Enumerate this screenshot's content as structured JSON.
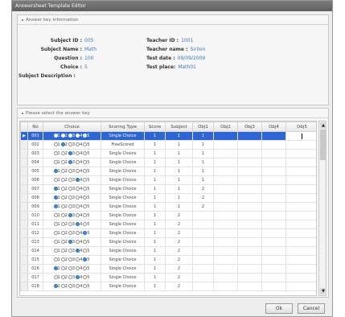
{
  "window": {
    "title": "Answersheet Template Editor"
  },
  "info": {
    "header": "Answer key Information",
    "subject_id_label": "Subject ID :",
    "subject_id": "005",
    "subject_name_label": "Subject Name :",
    "subject_name": "Math",
    "question_label": "Question :",
    "question": "100",
    "choice_label": "Choice :",
    "choice": "5",
    "subject_desc_label": "Subject Description :",
    "teacher_id_label": "Teacher ID :",
    "teacher_id": "1001",
    "teacher_name_label": "Teacher name :",
    "teacher_name": "Sirilon",
    "test_date_label": "Test date :",
    "test_date": "09/09/2009",
    "test_place_label": "Test place:",
    "test_place": "Math01"
  },
  "key": {
    "header": "Please select the answer key",
    "columns": [
      "No",
      "Choice",
      "Scoring Type",
      "Score",
      "Subject",
      "Obj1",
      "Obj2",
      "Obj3",
      "Obj4",
      "Obj5"
    ],
    "choice_numbers": [
      "1",
      "2",
      "3",
      "4",
      "5"
    ],
    "selected_row": 0,
    "current_row_marker": "▶",
    "rows": [
      {
        "no": "001",
        "on": [
          1,
          2,
          3,
          4
        ],
        "type": "Single Choice",
        "score": "1",
        "subject": "1",
        "obj1": "1"
      },
      {
        "no": "002",
        "on": [
          2
        ],
        "type": "FreeScored",
        "score": "1",
        "subject": "1",
        "obj1": "1"
      },
      {
        "no": "003",
        "on": [
          3
        ],
        "type": "Single Choice",
        "score": "1",
        "subject": "1",
        "obj1": "1"
      },
      {
        "no": "004",
        "on": [
          3
        ],
        "type": "Single Choice",
        "score": "1",
        "subject": "1",
        "obj1": "1"
      },
      {
        "no": "005",
        "on": [
          1
        ],
        "type": "Single Choice",
        "score": "1",
        "subject": "1",
        "obj1": "1"
      },
      {
        "no": "006",
        "on": [
          4
        ],
        "type": "Single Choice",
        "score": "1",
        "subject": "1",
        "obj1": "1"
      },
      {
        "no": "007",
        "on": [
          1
        ],
        "type": "Single Choice",
        "score": "1",
        "subject": "1",
        "obj1": "2"
      },
      {
        "no": "008",
        "on": [
          1
        ],
        "type": "Single Choice",
        "score": "1",
        "subject": "1",
        "obj1": "2"
      },
      {
        "no": "009",
        "on": [
          1
        ],
        "type": "Single Choice",
        "score": "1",
        "subject": "1",
        "obj1": "2"
      },
      {
        "no": "010",
        "on": [
          3
        ],
        "type": "Single Choice",
        "score": "1",
        "subject": "2",
        "obj1": ""
      },
      {
        "no": "011",
        "on": [
          4
        ],
        "type": "Single Choice",
        "score": "1",
        "subject": "2",
        "obj1": ""
      },
      {
        "no": "012",
        "on": [
          5
        ],
        "type": "Single Choice",
        "score": "1",
        "subject": "2",
        "obj1": ""
      },
      {
        "no": "013",
        "on": [
          3
        ],
        "type": "Single Choice",
        "score": "1",
        "subject": "2",
        "obj1": ""
      },
      {
        "no": "014",
        "on": [
          4
        ],
        "type": "Single Choice",
        "score": "1",
        "subject": "2",
        "obj1": ""
      },
      {
        "no": "015",
        "on": [
          5
        ],
        "type": "Single Choice",
        "score": "1",
        "subject": "2",
        "obj1": ""
      },
      {
        "no": "016",
        "on": [
          1
        ],
        "type": "Single Choice",
        "score": "1",
        "subject": "2",
        "obj1": ""
      },
      {
        "no": "017",
        "on": [
          4
        ],
        "type": "Single Choice",
        "score": "1",
        "subject": "2",
        "obj1": ""
      },
      {
        "no": "018",
        "on": [
          1
        ],
        "type": "Single Choice",
        "score": "1",
        "subject": "2",
        "obj1": ""
      }
    ]
  },
  "buttons": {
    "ok": "Ok",
    "cancel": "Cancel"
  },
  "scroll_icons": {
    "up": "▲",
    "down": "▼"
  },
  "colors": {
    "selection": "#2d66d3",
    "radio_on": "#3d8de0",
    "value_text": "#3a76c4"
  }
}
